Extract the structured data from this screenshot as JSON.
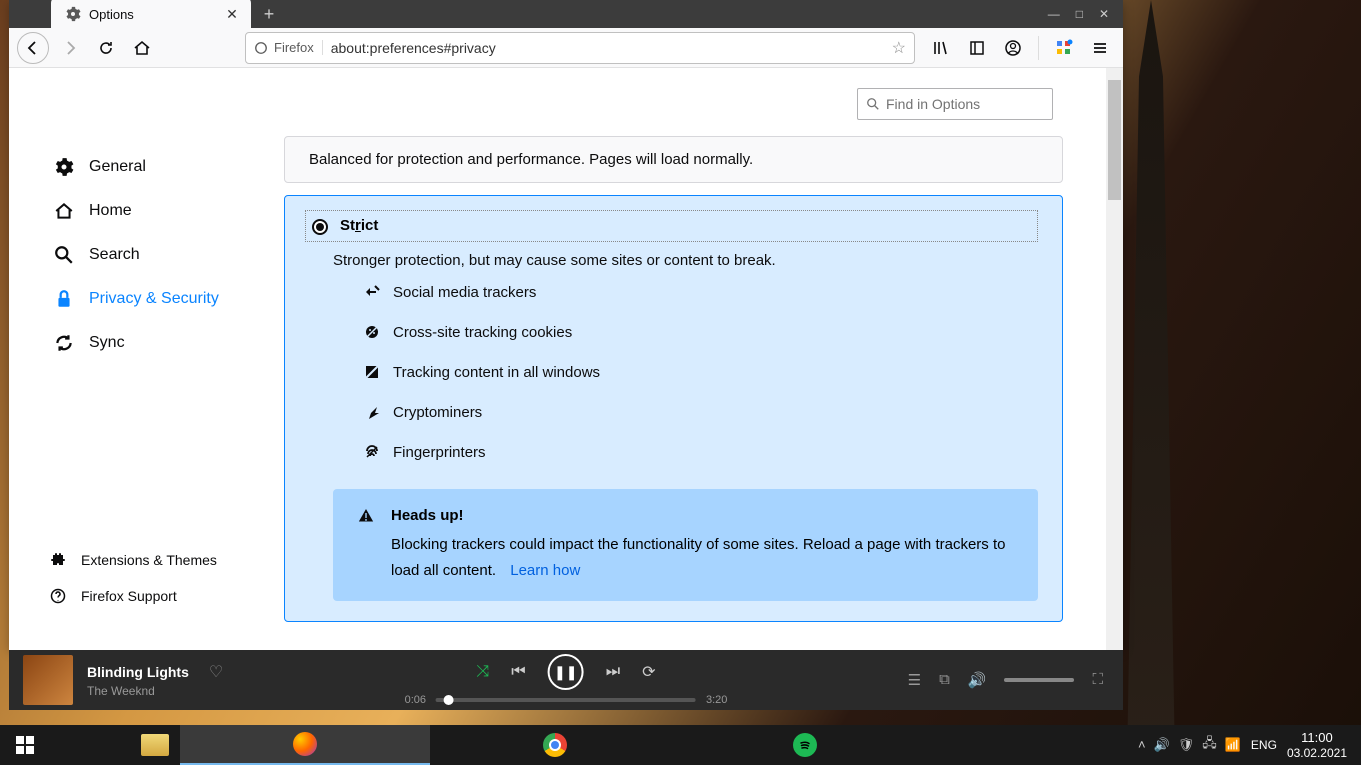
{
  "tab": {
    "title": "Options"
  },
  "url": {
    "identity": "Firefox",
    "value": "about:preferences#privacy"
  },
  "search": {
    "placeholder": "Find in Options"
  },
  "sidebar": {
    "general": "General",
    "home": "Home",
    "search": "Search",
    "privacy": "Privacy & Security",
    "sync": "Sync"
  },
  "footer": {
    "extensions": "Extensions & Themes",
    "support": "Firefox Support"
  },
  "standard_desc": "Balanced for protection and performance. Pages will load normally.",
  "strict": {
    "title_pre": "St",
    "title_u": "r",
    "title_post": "ict",
    "desc": "Stronger protection, but may cause some sites or content to break.",
    "items": {
      "social": "Social media trackers",
      "cookies": "Cross-site tracking cookies",
      "tracking": "Tracking content in all windows",
      "crypto": "Cryptominers",
      "finger": "Fingerprinters"
    },
    "headsup_title": "Heads up!",
    "headsup_text": "Blocking trackers could impact the functionality of some sites. Reload a page with trackers to load all content.",
    "learn_how": "Learn how"
  },
  "media": {
    "title": "Blinding Lights",
    "artist": "The Weeknd",
    "elapsed": "0:06",
    "duration": "3:20"
  },
  "tray": {
    "lang": "ENG",
    "time": "11:00",
    "date": "03.02.2021"
  }
}
